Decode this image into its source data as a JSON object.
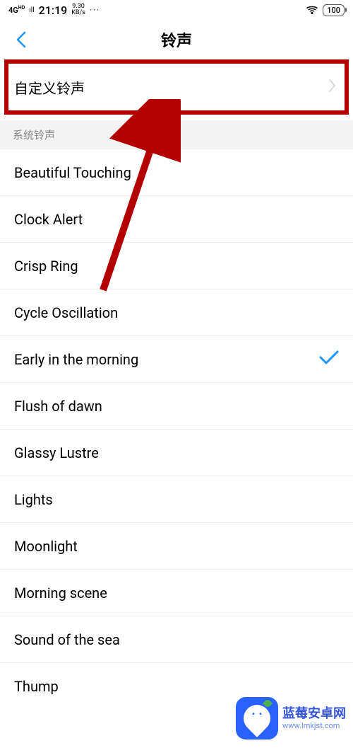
{
  "status_bar": {
    "network": "4G",
    "hd": "HD",
    "time": "21:19",
    "speed_val": "9.30",
    "speed_unit": "KB/s",
    "dots": "···",
    "battery": "100"
  },
  "header": {
    "title": "铃声"
  },
  "custom_ringtone": {
    "label": "自定义铃声"
  },
  "section": {
    "system_ringtones": "系统铃声"
  },
  "ringtones": [
    {
      "label": "Beautiful Touching",
      "selected": false
    },
    {
      "label": "Clock Alert",
      "selected": false
    },
    {
      "label": "Crisp Ring",
      "selected": false
    },
    {
      "label": "Cycle Oscillation",
      "selected": false
    },
    {
      "label": "Early in the morning",
      "selected": true
    },
    {
      "label": "Flush of dawn",
      "selected": false
    },
    {
      "label": "Glassy Lustre",
      "selected": false
    },
    {
      "label": "Lights",
      "selected": false
    },
    {
      "label": "Moonlight",
      "selected": false
    },
    {
      "label": "Morning scene",
      "selected": false
    },
    {
      "label": "Sound of the sea",
      "selected": false
    },
    {
      "label": "Thump",
      "selected": false
    }
  ],
  "watermark": {
    "title": "蓝莓安卓网",
    "url": "www.lmkjst.com"
  }
}
